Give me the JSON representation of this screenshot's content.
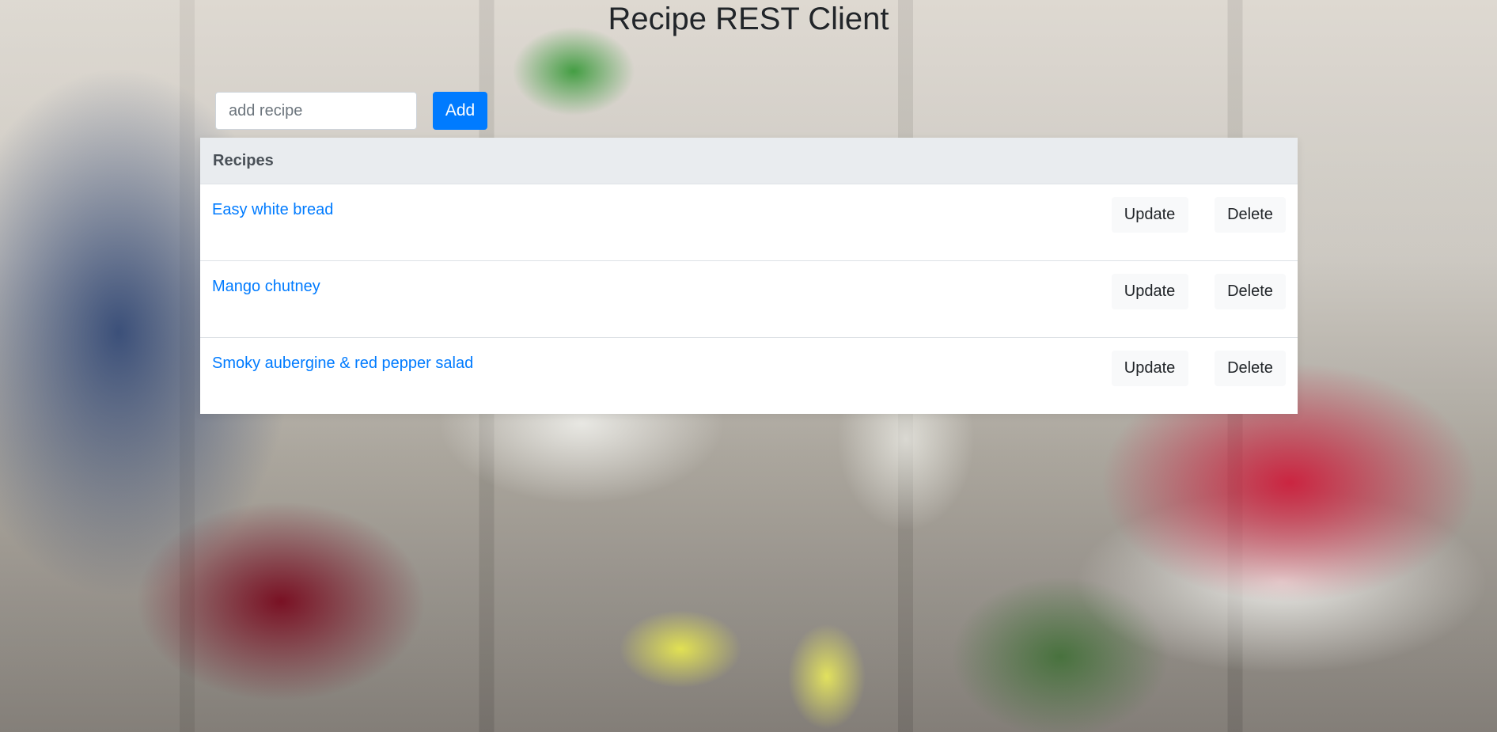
{
  "page": {
    "title": "Recipe REST Client"
  },
  "add_form": {
    "input_value": "",
    "placeholder": "add recipe",
    "button_label": "Add"
  },
  "table": {
    "header": "Recipes",
    "rows": [
      {
        "name": "Easy white bread",
        "update_label": "Update",
        "delete_label": "Delete"
      },
      {
        "name": "Mango chutney",
        "update_label": "Update",
        "delete_label": "Delete"
      },
      {
        "name": "Smoky aubergine & red pepper salad",
        "update_label": "Update",
        "delete_label": "Delete"
      }
    ]
  },
  "colors": {
    "primary": "#007bff",
    "table_header_bg": "#e9ecef",
    "button_bg": "#f8f9fa"
  }
}
